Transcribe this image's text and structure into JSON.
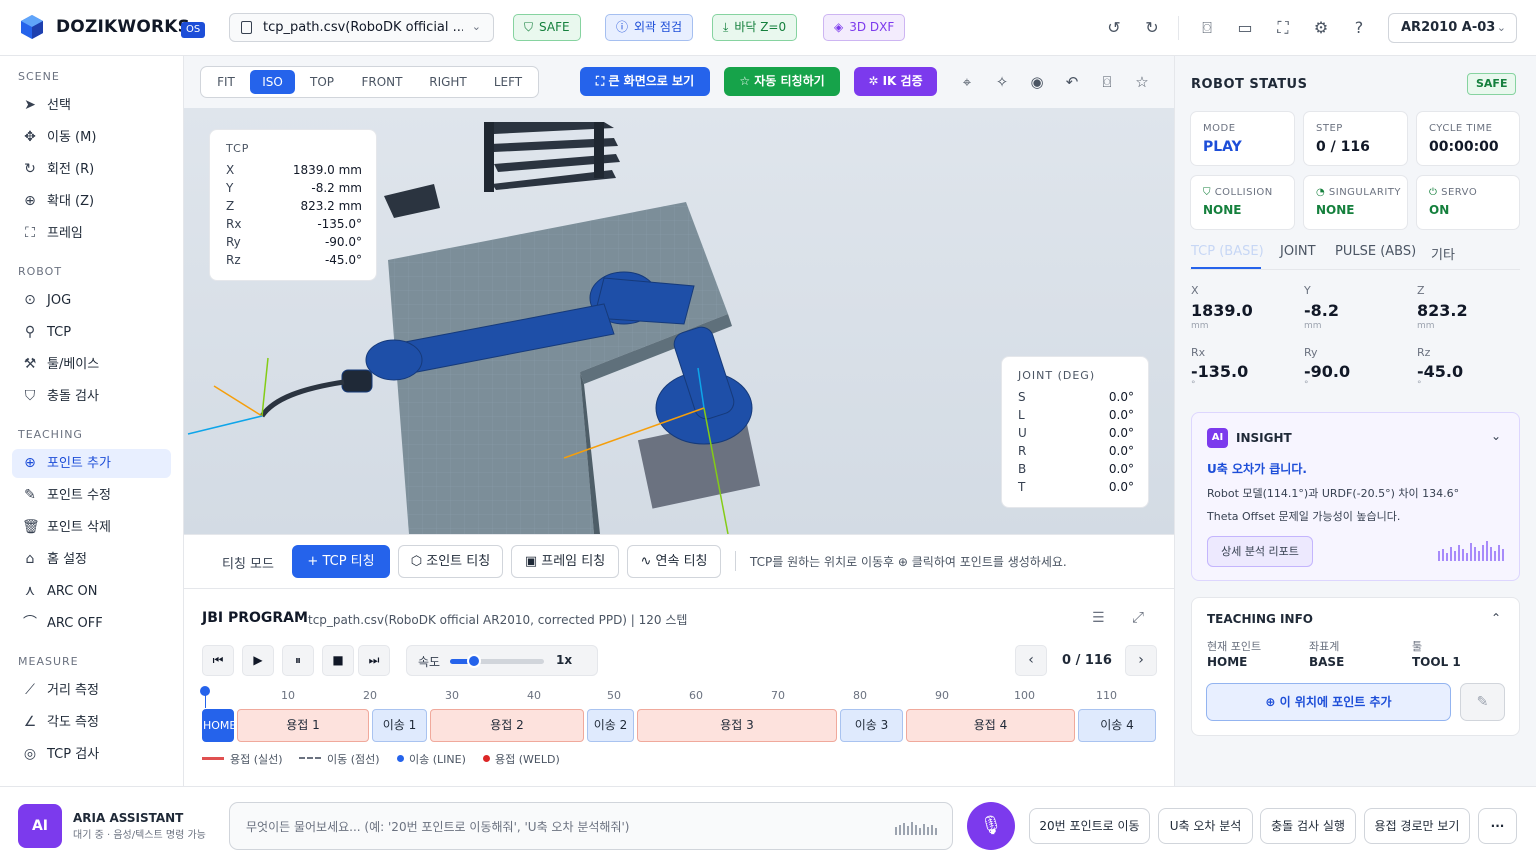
{
  "header": {
    "brand": "DOZIKWORKS",
    "os_badge": "OS",
    "file": "tcp_path.csv(RoboDK official ...",
    "chips": {
      "safe": "SAFE",
      "envelope": "외곽 점검",
      "floor": "바닥 Z=0",
      "dxf": "3D DXF"
    },
    "robot": "AR2010 A-03"
  },
  "sidebar": {
    "scene_label": "SCENE",
    "scene": [
      "선택",
      "이동 (M)",
      "회전 (R)",
      "확대 (Z)",
      "프레임"
    ],
    "robot_label": "ROBOT",
    "robot": [
      "JOG",
      "TCP",
      "툴/베이스",
      "충돌 검사"
    ],
    "teaching_label": "TEACHING",
    "teaching": [
      "포인트 추가",
      "포인트 수정",
      "포인트 삭제",
      "홈 설정",
      "ARC ON",
      "ARC OFF"
    ],
    "measure_label": "MEASURE",
    "measure": [
      "거리 측정",
      "각도 측정",
      "TCP 검사"
    ]
  },
  "view": {
    "tabs": [
      "FIT",
      "ISO",
      "TOP",
      "FRONT",
      "RIGHT",
      "LEFT"
    ],
    "active_tab": "ISO",
    "fullscreen": "큰 화면으로 보기",
    "auto_teach": "자동 티칭하기",
    "ik_check": "IK 검증"
  },
  "tcp_panel": {
    "title": "TCP",
    "rows": [
      {
        "k": "X",
        "v": "1839.0 mm"
      },
      {
        "k": "Y",
        "v": "-8.2 mm"
      },
      {
        "k": "Z",
        "v": "823.2 mm"
      },
      {
        "k": "Rx",
        "v": "-135.0°"
      },
      {
        "k": "Ry",
        "v": "-90.0°"
      },
      {
        "k": "Rz",
        "v": "-45.0°"
      }
    ]
  },
  "joint_panel": {
    "title": "JOINT (DEG)",
    "rows": [
      {
        "k": "S",
        "v": "0.0°"
      },
      {
        "k": "L",
        "v": "0.0°"
      },
      {
        "k": "U",
        "v": "0.0°"
      },
      {
        "k": "R",
        "v": "0.0°"
      },
      {
        "k": "B",
        "v": "0.0°"
      },
      {
        "k": "T",
        "v": "0.0°"
      }
    ]
  },
  "teach": {
    "mode_label": "티칭 모드",
    "tcp": "TCP 티칭",
    "joint": "조인트 티칭",
    "frame": "프레임 티칭",
    "cont": "연속 티칭",
    "hint": "TCP를 원하는 위치로 이동후 ⊕ 클릭하여 포인트를 생성하세요."
  },
  "program": {
    "title": "JBI PROGRAM",
    "subtitle": "tcp_path.csv(RoboDK official AR2010, corrected PPD) | 120 스텝",
    "speed_label": "속도",
    "speed_value": "1x",
    "speed_fraction": 0.25,
    "step": "0 / 116",
    "ticks": [
      "10",
      "20",
      "30",
      "40",
      "50",
      "60",
      "70",
      "80",
      "90",
      "100",
      "110"
    ],
    "segments": [
      {
        "label": "HOME",
        "kind": "home"
      },
      {
        "label": "용접 1",
        "kind": "weld"
      },
      {
        "label": "이송 1",
        "kind": "move"
      },
      {
        "label": "용접 2",
        "kind": "weld"
      },
      {
        "label": "이송 2",
        "kind": "move"
      },
      {
        "label": "용접 3",
        "kind": "weld"
      },
      {
        "label": "이송 3",
        "kind": "move"
      },
      {
        "label": "용접 4",
        "kind": "weld"
      },
      {
        "label": "이송 4",
        "kind": "move"
      }
    ],
    "legend": [
      "용접 (실선)",
      "이동 (점선)",
      "이송 (LINE)",
      "용접 (WELD)"
    ]
  },
  "status": {
    "title": "ROBOT STATUS",
    "badge": "SAFE",
    "mode_l": "MODE",
    "mode_v": "PLAY",
    "step_l": "STEP",
    "step_v": "0 / 116",
    "cycle_l": "CYCLE TIME",
    "cycle_v": "00:00:00",
    "coll_l": "COLLISION",
    "coll_v": "NONE",
    "sing_l": "SINGULARITY",
    "sing_v": "NONE",
    "servo_l": "SERVO",
    "servo_v": "ON",
    "tabs": [
      "TCP (BASE)",
      "JOINT",
      "PULSE (ABS)",
      "기타"
    ],
    "coords": [
      {
        "l": "X",
        "v": "1839.0",
        "u": "mm"
      },
      {
        "l": "Y",
        "v": "-8.2",
        "u": "mm"
      },
      {
        "l": "Z",
        "v": "823.2",
        "u": "mm"
      },
      {
        "l": "Rx",
        "v": "-135.0",
        "u": "°"
      },
      {
        "l": "Ry",
        "v": "-90.0",
        "u": "°"
      },
      {
        "l": "Rz",
        "v": "-45.0",
        "u": "°"
      }
    ]
  },
  "insight": {
    "badge": "AI",
    "title": "INSIGHT",
    "headline": "U축 오차가 큽니다.",
    "line1": "Robot 모델(114.1°)과 URDF(-20.5°) 차이 134.6°",
    "line2": "Theta Offset 문제일 가능성이 높습니다.",
    "button": "상세 분석 리포트"
  },
  "teaching_info": {
    "title": "TEACHING INFO",
    "cur_l": "현재 포인트",
    "cur_v": "HOME",
    "coord_l": "좌표계",
    "coord_v": "BASE",
    "tool_l": "툴",
    "tool_v": "TOOL 1",
    "add_btn": "이 위치에 포인트 추가"
  },
  "assistant": {
    "avatar": "AI",
    "name": "ARIA ASSISTANT",
    "status": "대기 중 · 음성/텍스트 명령 가능",
    "placeholder": "무엇이든 물어보세요... (예: '20번 포인트로 이동해줘', 'U축 오차 분석해줘')",
    "quick": [
      "20번 포인트로 이동",
      "U축 오차 분석",
      "충돌 검사 실행",
      "용접 경로만 보기"
    ],
    "more": "···"
  }
}
